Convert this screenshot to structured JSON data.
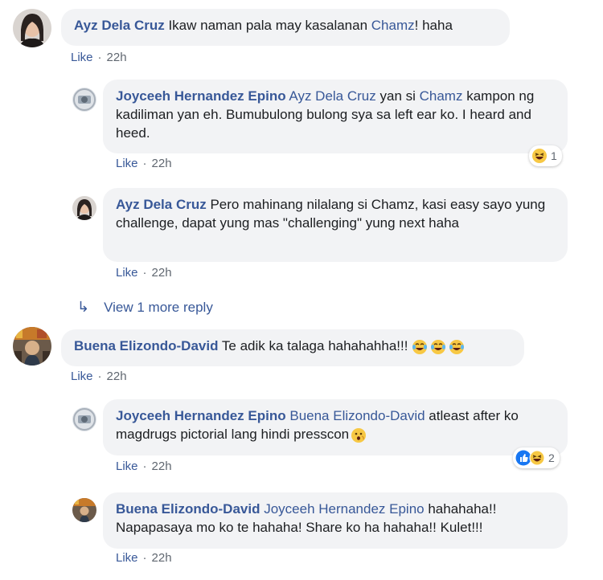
{
  "comments": [
    {
      "author": "Ayz Dela Cruz",
      "text_before": " Ikaw naman pala may kasalanan ",
      "mention": "Chamz",
      "text_after": "! haha",
      "like": "Like",
      "sep": "·",
      "time": "22h"
    },
    {
      "author": "Joyceeh Hernandez Epino",
      "mention1": "Ayz Dela Cruz",
      "text_mid": " yan si ",
      "mention2": "Chamz",
      "text_after": " kampon ng kadiliman yan eh. Bumubulong bulong sya sa left ear ko. I heard and heed.",
      "like": "Like",
      "sep": "·",
      "time": "22h",
      "reaction_count": "1"
    },
    {
      "author": "Ayz Dela Cruz",
      "text": " Pero mahinang nilalang si Chamz, kasi easy sayo yung challenge, dapat yung mas \"challenging\" yung next haha",
      "like": "Like",
      "sep": "·",
      "time": "22h"
    },
    {
      "view_more": "View 1 more reply"
    },
    {
      "author": "Buena Elizondo-David",
      "text": " Te adik ka talaga hahahahha!!!",
      "like": "Like",
      "sep": "·",
      "time": "22h"
    },
    {
      "author": "Joyceeh Hernandez Epino",
      "mention": "Buena Elizondo-David",
      "text_after": " atleast after ko magdrugs pictorial lang hindi presscon",
      "like": "Like",
      "sep": "·",
      "time": "22h",
      "reaction_count": "2"
    },
    {
      "author": "Buena Elizondo-David",
      "mention": "Joyceeh Hernandez Epino",
      "text_after": " hahahaha!! Napapasaya mo ko te hahaha! Share ko ha hahaha!! Kulet!!!",
      "like": "Like",
      "sep": "·",
      "time": "22h"
    }
  ],
  "colors": {
    "link": "#385898",
    "bubble": "#f2f3f5",
    "meta": "#606770"
  },
  "icons": [
    "haha-emoji",
    "like-reaction-icon",
    "reply-arrow-icon",
    "laughing-tears-emoji",
    "hushed-emoji"
  ]
}
